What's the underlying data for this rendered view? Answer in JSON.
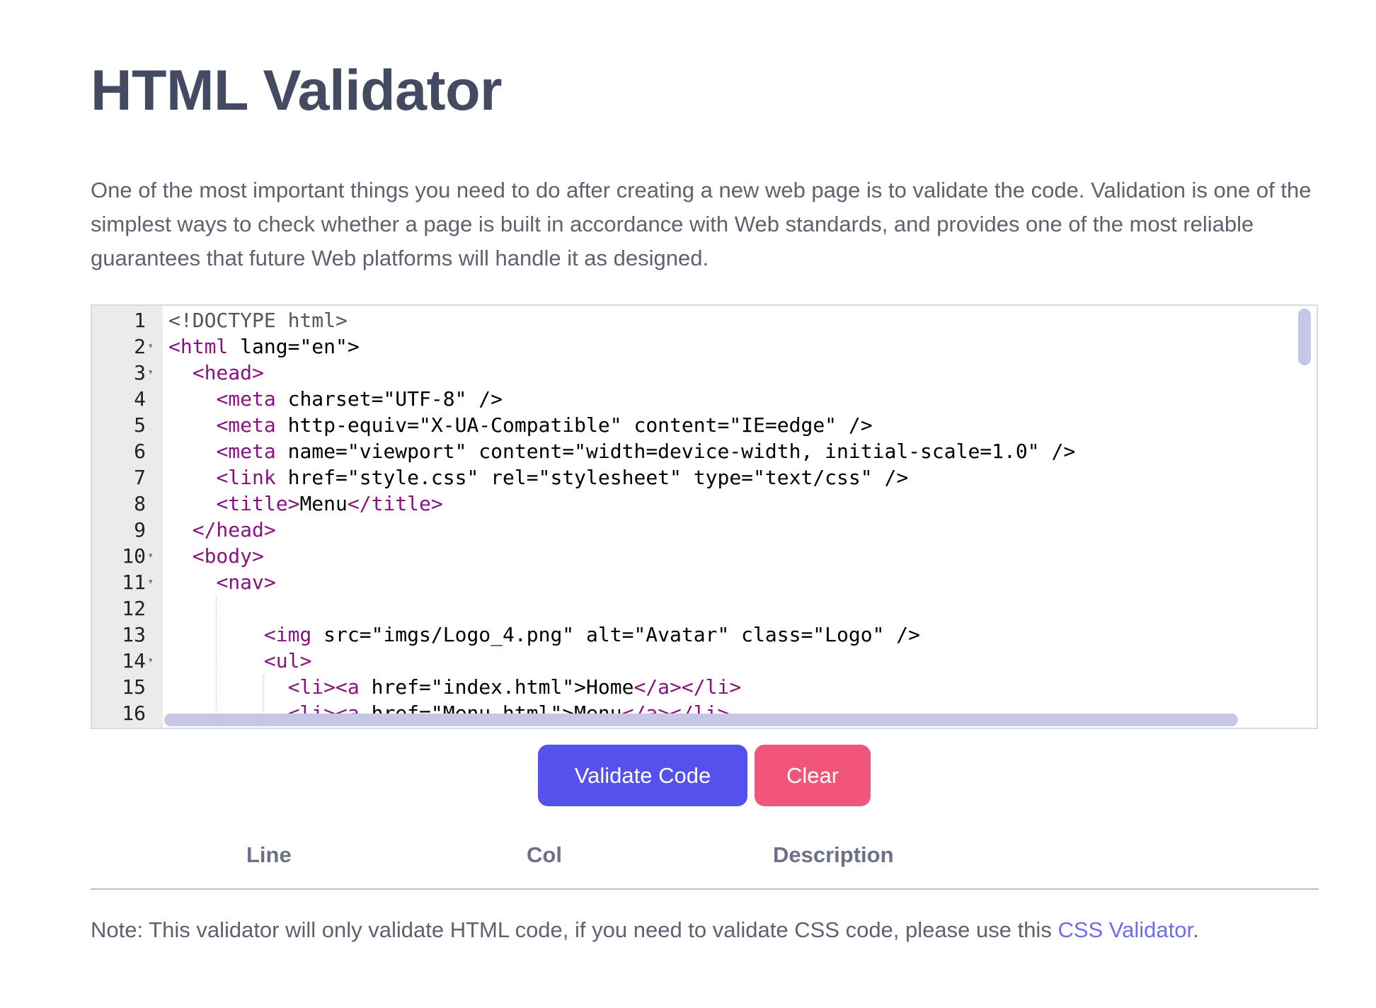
{
  "page": {
    "title": "HTML Validator",
    "intro": "One of the most important things you need to do after creating a new web page is to validate the code. Validation is one of the simplest ways to check whether a page is built in accordance with Web standards, and provides one of the most reliable guarantees that future Web platforms will handle it as designed."
  },
  "editor": {
    "line_numbers": [
      "1",
      "2",
      "3",
      "4",
      "5",
      "6",
      "7",
      "8",
      "9",
      "10",
      "11",
      "12",
      "13",
      "14",
      "15",
      "16"
    ],
    "lines": [
      "<!DOCTYPE html>",
      "<html lang=\"en\">",
      "  <head>",
      "    <meta charset=\"UTF-8\" />",
      "    <meta http-equiv=\"X-UA-Compatible\" content=\"IE=edge\" />",
      "    <meta name=\"viewport\" content=\"width=device-width, initial-scale=1.0\" />",
      "    <link href=\"style.css\" rel=\"stylesheet\" type=\"text/css\" />",
      "    <title>Menu</title>",
      "  </head>",
      "  <body>",
      "    <nav>",
      "",
      "        <img src=\"imgs/Logo_4.png\" alt=\"Avatar\" class=\"Logo\" />",
      "        <ul>",
      "          <li><a href=\"index.html\">Home</a></li>",
      "          <li><a href=\"Menu.html\">Menu</a></li>"
    ],
    "fold_marker": "▾"
  },
  "buttons": {
    "validate": "Validate Code",
    "clear": "Clear"
  },
  "results_table": {
    "headers": [
      "Line",
      "Col",
      "Description"
    ]
  },
  "note": {
    "text": "Note: This validator will only validate HTML code, if you need to validate CSS code, please use this ",
    "link_text": "CSS Validator",
    "suffix": "."
  },
  "colors": {
    "title": "#434a62",
    "validate_button": "#5551ec",
    "clear_button": "#f2557a",
    "link": "#6e6cf0",
    "tag": "#881280",
    "attribute": "#994500",
    "value": "#1a1aa6"
  }
}
